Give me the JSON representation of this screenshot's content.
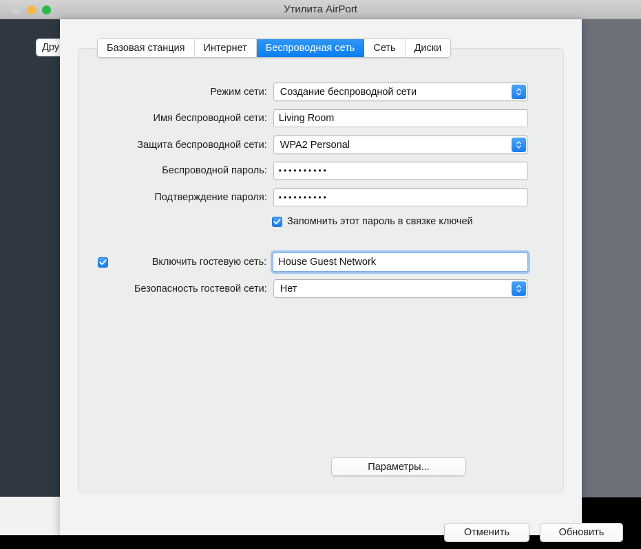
{
  "window": {
    "title": "Утилита AirPort",
    "traffic_lights": [
      {
        "name": "close",
        "color": "#cecece"
      },
      {
        "name": "minimize",
        "color": "#f6b93f"
      },
      {
        "name": "zoom",
        "color": "#2eb84a"
      }
    ]
  },
  "background": {
    "clipped_button_label": "Дру"
  },
  "tabs": [
    {
      "id": "base-station",
      "label": "Базовая станция",
      "active": false
    },
    {
      "id": "internet",
      "label": "Интернет",
      "active": false
    },
    {
      "id": "wireless",
      "label": "Беспроводная сеть",
      "active": true
    },
    {
      "id": "network",
      "label": "Сеть",
      "active": false
    },
    {
      "id": "disks",
      "label": "Диски",
      "active": false
    }
  ],
  "form": {
    "network_mode": {
      "label": "Режим сети:",
      "value": "Создание беспроводной сети"
    },
    "network_name": {
      "label": "Имя беспроводной сети:",
      "value": "Living Room"
    },
    "network_security": {
      "label": "Защита беспроводной сети:",
      "value": "WPA2 Personal"
    },
    "wireless_password": {
      "label": "Беспроводной пароль:",
      "value": "••••••••••"
    },
    "confirm_password": {
      "label": "Подтверждение пароля:",
      "value": "••••••••••"
    },
    "remember_password": {
      "label": "Запомнить этот пароль в связке ключей",
      "checked": true
    },
    "guest_network": {
      "label": "Включить гостевую сеть:",
      "checked": true,
      "value": "House Guest Network",
      "focused": true
    },
    "guest_security": {
      "label": "Безопасность гостевой сети:",
      "value": "Нет"
    }
  },
  "buttons": {
    "options": "Параметры...",
    "cancel": "Отменить",
    "update": "Обновить"
  },
  "colors": {
    "accent_blue": "#0a7ef0",
    "titlebar": "#c6c6c6",
    "sheet_bg": "#f3f3f4",
    "tabview_bg": "#eceded",
    "backdrop_dark": "#2f3742"
  }
}
